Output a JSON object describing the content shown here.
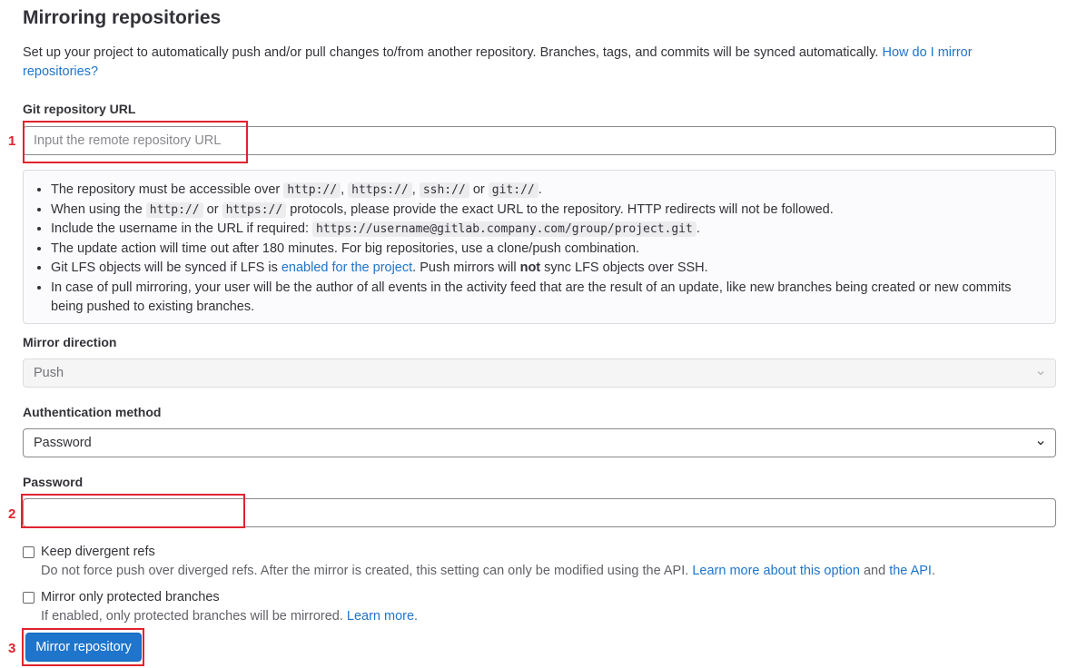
{
  "page": {
    "title": "Mirroring repositories",
    "intro_text": "Set up your project to automatically push and/or pull changes to/from another repository. Branches, tags, and commits will be synced automatically.",
    "intro_link": "How do I mirror repositories?"
  },
  "git_url": {
    "label": "Git repository URL",
    "placeholder": "Input the remote repository URL",
    "value": ""
  },
  "info": {
    "item1_text": "The repository must be accessible over",
    "item1_code": [
      "http://",
      "https://",
      "ssh://",
      "git://"
    ],
    "item1_sep1": ",",
    "item1_sep2": ",",
    "item1_or": "or",
    "item1_end": ".",
    "item2_a": "When using the",
    "item2_code1": "http://",
    "item2_or": "or",
    "item2_code2": "https://",
    "item2_b": "protocols, please provide the exact URL to the repository. HTTP redirects will not be followed.",
    "item3_a": "Include the username in the URL if required:",
    "item3_code": "https://username@gitlab.company.com/group/project.git",
    "item3_end": ".",
    "item4": "The update action will time out after 180 minutes. For big repositories, use a clone/push combination.",
    "item5_a": "Git LFS objects will be synced if LFS is",
    "item5_link": "enabled for the project",
    "item5_b": ". Push mirrors will",
    "item5_bold": "not",
    "item5_c": "sync LFS objects over SSH.",
    "item6": "In case of pull mirroring, your user will be the author of all events in the activity feed that are the result of an update, like new branches being created or new commits being pushed to existing branches."
  },
  "mirror_direction": {
    "label": "Mirror direction",
    "value": "Push"
  },
  "auth": {
    "label": "Authentication method",
    "value": "Password"
  },
  "password": {
    "label": "Password",
    "value": ""
  },
  "keep_divergent": {
    "label": "Keep divergent refs",
    "help_text": "Do not force push over diverged refs. After the mirror is created, this setting can only be modified using the API.",
    "help_link1": "Learn more about this option",
    "help_and": "and",
    "help_link2": "the API",
    "help_end": "."
  },
  "protected_only": {
    "label": "Mirror only protected branches",
    "help_text": "If enabled, only protected branches will be mirrored.",
    "help_link": "Learn more."
  },
  "submit": {
    "label": "Mirror repository"
  },
  "annotations": {
    "marker1": "1",
    "marker2": "2",
    "marker3": "3",
    "color": "#e0232e"
  },
  "colors": {
    "accent": "#1f75cb",
    "text": "#333238"
  }
}
